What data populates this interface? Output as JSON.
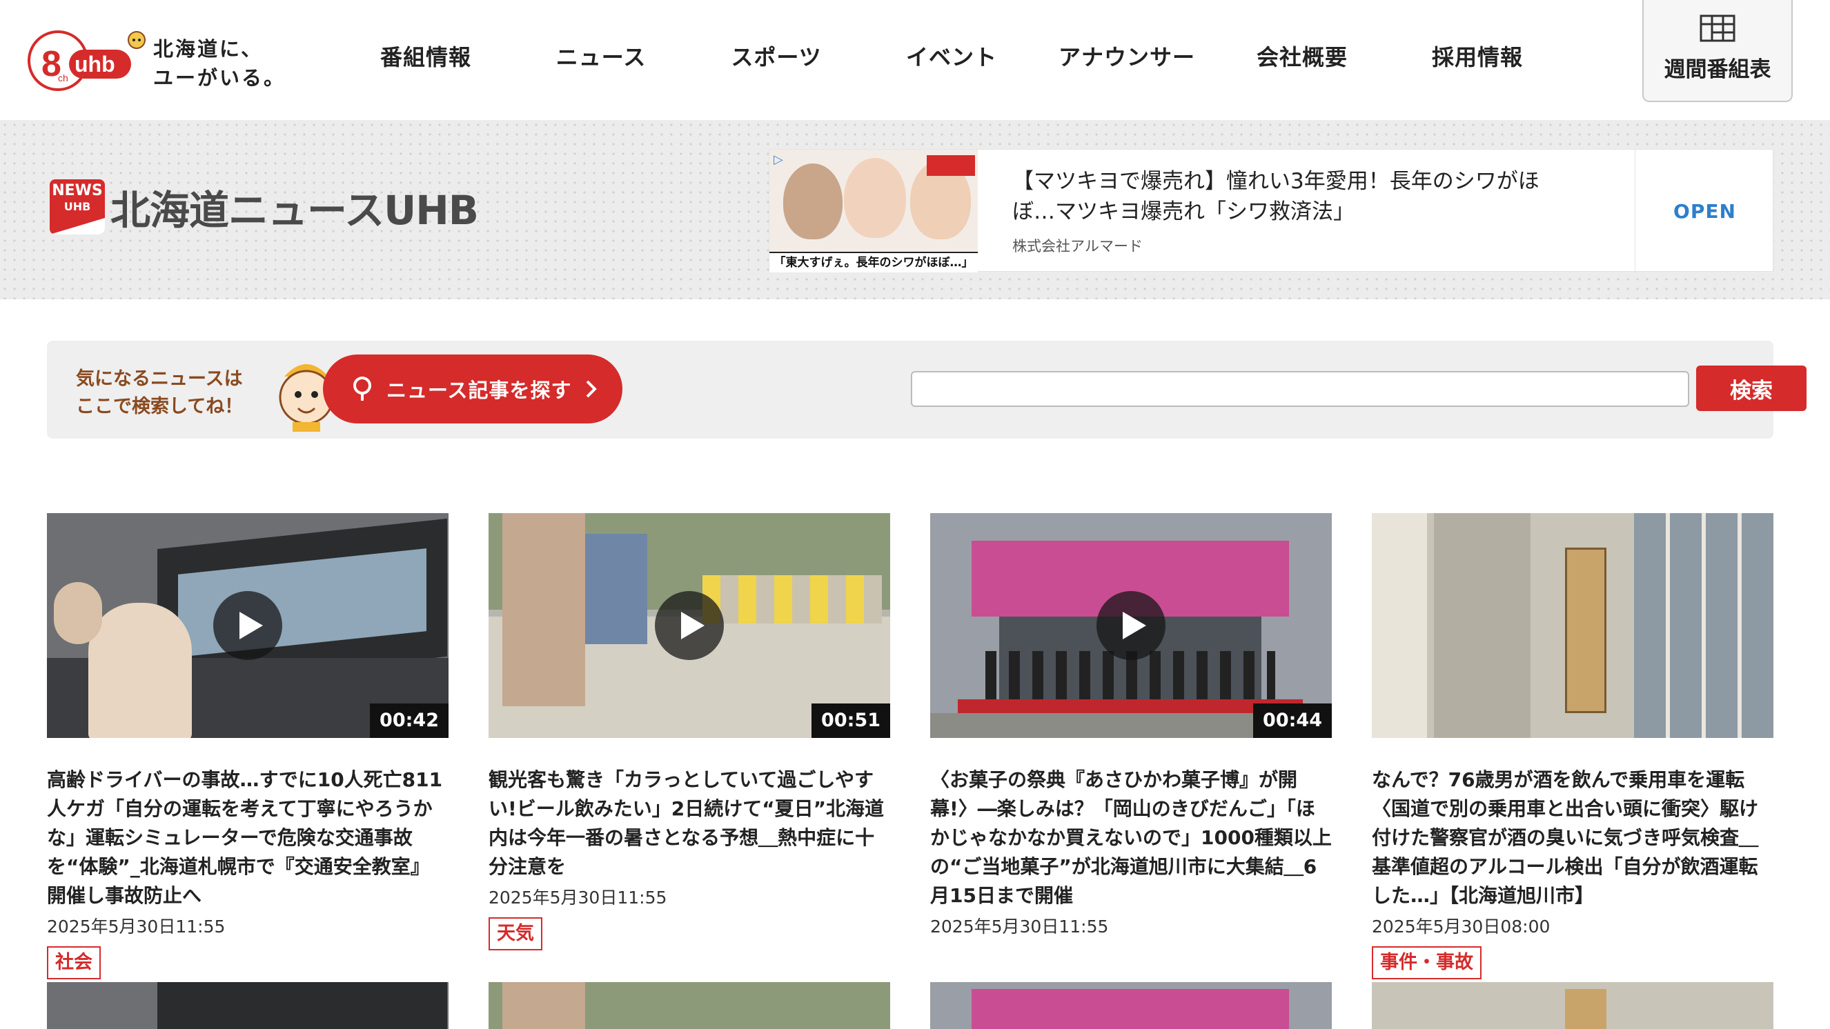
{
  "header": {
    "logo_channel": "8",
    "logo_ch": "ch",
    "logo_brand": "uhb",
    "tagline_line1": "北海道に、",
    "tagline_line2": "ユーがいる。",
    "nav": [
      "番組情報",
      "ニュース",
      "スポーツ",
      "イベント",
      "アナウンサー",
      "会社概要",
      "採用情報"
    ],
    "weekly_label": "週間番組表"
  },
  "banner": {
    "badge_top": "NEWS",
    "badge_sub": "UHB",
    "brand_name": "北海道ニュースUHB",
    "ad": {
      "image_caption": "「東大すげぇ。長年のシワがほぼ…」",
      "text": "【マツキヨで爆売れ】憧れい3年愛用！長年のシワがほぼ…マツキヨ爆売れ「シワ救済法」",
      "sponsor": "株式会社アルマード",
      "open_label": "OPEN"
    }
  },
  "search": {
    "hint_line1": "気になるニュースは",
    "hint_line2": "ここで検索してね！",
    "pill_label": "ニュース記事を探す",
    "input_value": "",
    "button_label": "検索"
  },
  "articles": [
    {
      "duration": "00:42",
      "title": "高齢ドライバーの事故…すでに10人死亡811人ケガ「自分の運転を考えて丁寧にやろうかな」運転シミュレーターで危険な交通事故を“体験”_北海道札幌市で『交通安全教室』開催し事故防止へ",
      "date": "2025年5月30日11:55",
      "tag": "社会"
    },
    {
      "duration": "00:51",
      "title": "観光客も驚き「カラっとしていて過ごしやすい!ビール飲みたい」2日続けて“夏日”北海道内は今年一番の暑さとなる予想＿熱中症に十分注意を",
      "date": "2025年5月30日11:55",
      "tag": "天気"
    },
    {
      "duration": "00:44",
      "title": "〈お菓子の祭典『あさひかわ菓子博』が開幕!〉―楽しみは？「岡山のきびだんご」「ほかじゃなかなか買えないので」1000種類以上の“ご当地菓子”が北海道旭川市に大集結＿6月15日まで開催",
      "date": "2025年5月30日11:55",
      "tag": ""
    },
    {
      "duration": "",
      "title": "なんで？76歳男が酒を飲んで乗用車を運転〈国道で別の乗用車と出合い頭に衝突〉駆け付けた警察官が酒の臭いに気づき呼気検査＿基準値超のアルコール検出「自分が飲酒運転した…」【北海道旭川市】",
      "date": "2025年5月30日08:00",
      "tag": "事件・事故"
    }
  ],
  "colors": {
    "accent_red": "#d52b2b",
    "ad_open_blue": "#2e7fcc"
  }
}
